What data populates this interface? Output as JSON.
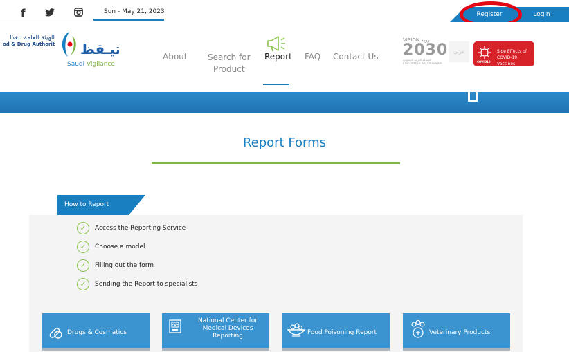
{
  "topbar": {
    "social": [
      {
        "icon": "facebook-icon",
        "glyph": "f"
      },
      {
        "icon": "twitter-icon",
        "glyph": "🐦"
      },
      {
        "icon": "instagram-icon",
        "glyph": "◘"
      }
    ],
    "date": "Sun - May 21, 2023",
    "register_label": "Register",
    "login_label": "Login",
    "accent": "#1a7fc1"
  },
  "header": {
    "sfda_ar": "الهيئة العامة للغذا",
    "sfda_en": "od & Drug Authority",
    "logo_ar": "تيـقظ",
    "logo_en_1": "Saudi ",
    "logo_en_2": "Vigilance",
    "nav": [
      {
        "label": "About"
      },
      {
        "label": "Search for\nProduct"
      },
      {
        "label": "Report"
      },
      {
        "label": "FAQ"
      },
      {
        "label": "Contact Us"
      }
    ],
    "vision_top": "VISION رؤية",
    "vision_year": "2030",
    "vision_sub": "المملكة العربية السعودية KINGDOM OF SAUDI ARABIA",
    "lang_label": "عربي",
    "covid_label": "Side Effects of\nCOVID-19 Vaccines",
    "covid_badge": "COVID19"
  },
  "main": {
    "title": "Report Forms",
    "how_to_report": "How to Report",
    "steps": [
      "Access the Reporting Service",
      "Choose a model",
      "Filling out the form",
      "Sending the Report to specialists"
    ],
    "cards": [
      {
        "label": "Drugs & Cosmatics",
        "icon": "pills-icon"
      },
      {
        "label": "National Center for\nMedical Devices\nReporting",
        "icon": "device-icon"
      },
      {
        "label": "Food Poisoning Report",
        "icon": "food-bowl-icon"
      },
      {
        "label": "Veterinary Products",
        "icon": "paw-icon"
      }
    ]
  }
}
